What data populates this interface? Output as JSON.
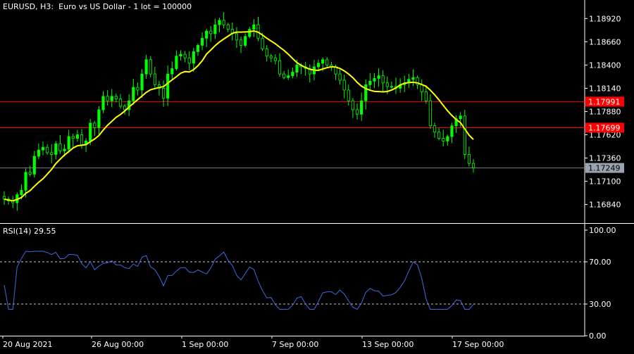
{
  "header": {
    "symbol": "EURUSD",
    "timeframe": "H3:",
    "description": "Euro vs US Dollar - 1 lot = 100000"
  },
  "rsi_header": {
    "label": "RSI(14) 29.55"
  },
  "colors": {
    "background": "#000000",
    "bull_candle": "#00ff00",
    "ma_line": "#ffff00",
    "rsi_line": "#4169e1",
    "level_line": "#ff0000",
    "level_tag": "#ff0000",
    "bid_line": "#808080",
    "bid_tag": "#9aa3b0",
    "axis_text": "#ffffff"
  },
  "chart_data": [
    {
      "type": "candlestick",
      "title": "EURUSD, H3:  Euro vs US Dollar - 1 lot = 100000",
      "x_tick_labels": [
        "20 Aug 2021",
        "26 Aug 00:00",
        "1 Sep 00:00",
        "7 Sep 00:00",
        "13 Sep 00:00",
        "17 Sep 00:00"
      ],
      "y_tick_labels": [
        "1.18920",
        "1.18660",
        "1.18400",
        "1.18140",
        "1.17880",
        "1.17620",
        "1.17360",
        "1.17100",
        "1.16840"
      ],
      "ylim": [
        1.1664,
        1.1908
      ],
      "horizontal_levels": [
        {
          "value": 1.17991,
          "label": "1.17991"
        },
        {
          "value": 1.17699,
          "label": "1.17699"
        }
      ],
      "bid": {
        "value": 1.17249,
        "label": "1.17249"
      },
      "close": [
        1.169,
        1.1688,
        1.1686,
        1.1695,
        1.17,
        1.172,
        1.1718,
        1.1738,
        1.1745,
        1.1748,
        1.1742,
        1.174,
        1.1752,
        1.1744,
        1.1746,
        1.176,
        1.1758,
        1.1762,
        1.1751,
        1.1755,
        1.1775,
        1.177,
        1.179,
        1.1805,
        1.18,
        1.1805,
        1.1802,
        1.1794,
        1.179,
        1.18,
        1.1815,
        1.1812,
        1.183,
        1.1846,
        1.183,
        1.1818,
        1.1814,
        1.1803,
        1.183,
        1.1836,
        1.185,
        1.1852,
        1.1848,
        1.1842,
        1.1855,
        1.1862,
        1.187,
        1.1878,
        1.1875,
        1.1885,
        1.189,
        1.1885,
        1.188,
        1.1875,
        1.1868,
        1.1862,
        1.1872,
        1.188,
        1.1885,
        1.187,
        1.1858,
        1.185,
        1.1848,
        1.1845,
        1.183,
        1.1826,
        1.1828,
        1.1832,
        1.184,
        1.1838,
        1.1836,
        1.183,
        1.1838,
        1.1842,
        1.1846,
        1.184,
        1.1838,
        1.183,
        1.1823,
        1.1812,
        1.18,
        1.179,
        1.1785,
        1.18,
        1.1818,
        1.1822,
        1.1825,
        1.1828,
        1.182,
        1.1816,
        1.1816,
        1.1814,
        1.1818,
        1.182,
        1.1824,
        1.1826,
        1.1818,
        1.181,
        1.18,
        1.1772,
        1.1765,
        1.1758,
        1.1755,
        1.176,
        1.1772,
        1.178,
        1.1783,
        1.174,
        1.173,
        1.1725
      ]
    },
    {
      "type": "line",
      "title": "RSI(14) 29.55",
      "y_tick_labels": [
        "100.00",
        "70.00",
        "30.00",
        "0.00"
      ],
      "ylim": [
        0,
        100
      ],
      "levels": [
        70,
        30
      ],
      "last_value": 29.55
    }
  ]
}
